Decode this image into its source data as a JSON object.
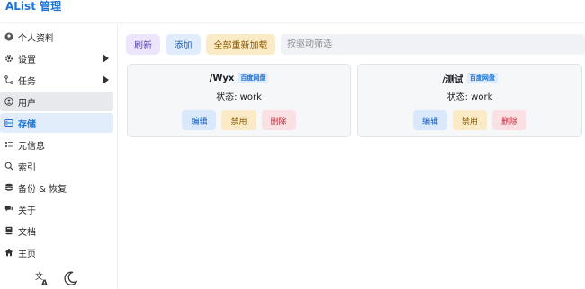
{
  "header": {
    "brand": "AList 管理"
  },
  "sidebar": {
    "items": [
      {
        "label": "个人资料",
        "icon": "user-circle-icon"
      },
      {
        "label": "设置",
        "icon": "gear-icon",
        "has_submenu": true
      },
      {
        "label": "任务",
        "icon": "route-icon",
        "has_submenu": true
      },
      {
        "label": "用户",
        "icon": "user-icon",
        "selected": true
      },
      {
        "label": "存储",
        "icon": "storage-icon",
        "active": true
      },
      {
        "label": "元信息",
        "icon": "metadata-icon"
      },
      {
        "label": "索引",
        "icon": "search-icon"
      },
      {
        "label": "备份 & 恢复",
        "icon": "database-icon"
      },
      {
        "label": "关于",
        "icon": "chat-icon"
      },
      {
        "label": "文档",
        "icon": "book-icon"
      },
      {
        "label": "主页",
        "icon": "home-icon"
      }
    ],
    "bottom_tools": [
      "translate-icon",
      "moon-icon"
    ]
  },
  "toolbar": {
    "refresh_label": "刷新",
    "add_label": "添加",
    "reload_all_label": "全部重新加载",
    "filter_placeholder": "按驱动筛选"
  },
  "storages": [
    {
      "path": "/Wyx",
      "driver": "百度网盘",
      "status_label": "状态:",
      "status": "work",
      "edit": "编辑",
      "disable": "禁用",
      "delete": "删除"
    },
    {
      "path": "/测试",
      "driver": "百度网盘",
      "status_label": "状态:",
      "status": "work",
      "edit": "编辑",
      "disable": "禁用",
      "delete": "删除"
    }
  ],
  "colors": {
    "accent": "#1a73d8",
    "active_bg": "#e2edfb",
    "selected_bg": "#e7e9ec"
  }
}
